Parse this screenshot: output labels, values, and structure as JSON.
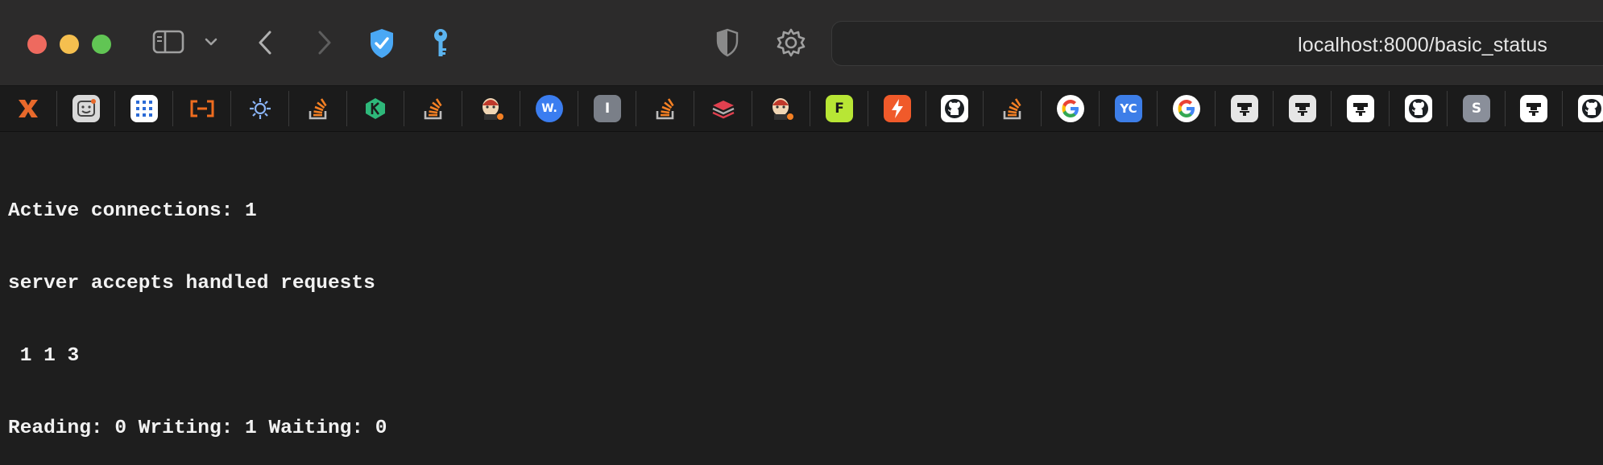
{
  "toolbar": {
    "url": "localhost:8000/basic_status",
    "icons": [
      "sidebar-icon",
      "chevron-down-icon",
      "back-icon",
      "forward-icon",
      "shield-check-icon",
      "key-icon",
      "privacy-shield-icon",
      "gear-icon"
    ]
  },
  "bookmarks": [
    {
      "icon": "cross-logo-icon",
      "text": "",
      "color": "#e8692b"
    },
    {
      "icon": "face-icon",
      "text": "",
      "color": "#d9d9d9"
    },
    {
      "icon": "grid-icon",
      "text": "",
      "color": "#2b6bd6"
    },
    {
      "icon": "bracket-icon",
      "text": "",
      "color": "#ef6c1f"
    },
    {
      "icon": "gear-bot-icon",
      "text": "",
      "color": "#8ab4f8"
    },
    {
      "icon": "stackoverflow-icon",
      "text": "",
      "color": "#f48024"
    },
    {
      "icon": "leaf-logo-icon",
      "text": "",
      "color": "#2eb87a"
    },
    {
      "icon": "stackoverflow-icon",
      "text": "",
      "color": "#f48024"
    },
    {
      "icon": "jenkins-icon",
      "text": "",
      "color": "#d4a373"
    },
    {
      "icon": "w-logo-icon",
      "text": "W.",
      "color": "#3b7df0"
    },
    {
      "icon": "i-logo-icon",
      "text": "I",
      "color": "#7a7f88"
    },
    {
      "icon": "stackoverflow-icon",
      "text": "",
      "color": "#f48024"
    },
    {
      "icon": "stack-logo-icon",
      "text": "",
      "color": "#e0404f"
    },
    {
      "icon": "jenkins-icon",
      "text": "",
      "color": "#d4a373"
    },
    {
      "icon": "f-logo-icon",
      "text": "F",
      "color": "#b8e635"
    },
    {
      "icon": "bolt-logo-icon",
      "text": "",
      "color": "#f05a2a"
    },
    {
      "icon": "github-icon",
      "text": "",
      "color": "#ffffff"
    },
    {
      "icon": "stackoverflow-icon",
      "text": "",
      "color": "#f48024"
    },
    {
      "icon": "google-icon",
      "text": "G",
      "color": "#ffffff"
    },
    {
      "icon": "yc-icon",
      "text": "YC",
      "color": "#3d7ee8"
    },
    {
      "icon": "google-icon",
      "text": "G",
      "color": "#ffffff"
    },
    {
      "icon": "mask-icon",
      "text": "",
      "color": "#e6e6e6"
    },
    {
      "icon": "mask-icon",
      "text": "",
      "color": "#e6e6e6"
    },
    {
      "icon": "mask-icon",
      "text": "",
      "color": "#ffffff"
    },
    {
      "icon": "github-icon",
      "text": "",
      "color": "#ffffff"
    },
    {
      "icon": "s-logo-icon",
      "text": "S",
      "color": "#8a8f9a"
    },
    {
      "icon": "mask-icon",
      "text": "",
      "color": "#ffffff"
    },
    {
      "icon": "github-icon",
      "text": "",
      "color": "#ffffff"
    }
  ],
  "content": {
    "line1": "Active connections: 1",
    "line2": "server accepts handled requests",
    "line3": " 1 1 3",
    "line4": "Reading: 0 Writing: 1 Waiting: 0"
  }
}
